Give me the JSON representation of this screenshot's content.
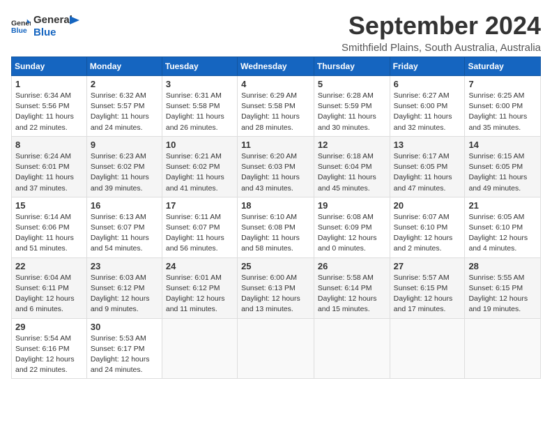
{
  "logo": {
    "line1": "General",
    "line2": "Blue"
  },
  "title": "September 2024",
  "location": "Smithfield Plains, South Australia, Australia",
  "headers": [
    "Sunday",
    "Monday",
    "Tuesday",
    "Wednesday",
    "Thursday",
    "Friday",
    "Saturday"
  ],
  "weeks": [
    [
      {
        "day": "1",
        "detail": "Sunrise: 6:34 AM\nSunset: 5:56 PM\nDaylight: 11 hours\nand 22 minutes."
      },
      {
        "day": "2",
        "detail": "Sunrise: 6:32 AM\nSunset: 5:57 PM\nDaylight: 11 hours\nand 24 minutes."
      },
      {
        "day": "3",
        "detail": "Sunrise: 6:31 AM\nSunset: 5:58 PM\nDaylight: 11 hours\nand 26 minutes."
      },
      {
        "day": "4",
        "detail": "Sunrise: 6:29 AM\nSunset: 5:58 PM\nDaylight: 11 hours\nand 28 minutes."
      },
      {
        "day": "5",
        "detail": "Sunrise: 6:28 AM\nSunset: 5:59 PM\nDaylight: 11 hours\nand 30 minutes."
      },
      {
        "day": "6",
        "detail": "Sunrise: 6:27 AM\nSunset: 6:00 PM\nDaylight: 11 hours\nand 32 minutes."
      },
      {
        "day": "7",
        "detail": "Sunrise: 6:25 AM\nSunset: 6:00 PM\nDaylight: 11 hours\nand 35 minutes."
      }
    ],
    [
      {
        "day": "8",
        "detail": "Sunrise: 6:24 AM\nSunset: 6:01 PM\nDaylight: 11 hours\nand 37 minutes."
      },
      {
        "day": "9",
        "detail": "Sunrise: 6:23 AM\nSunset: 6:02 PM\nDaylight: 11 hours\nand 39 minutes."
      },
      {
        "day": "10",
        "detail": "Sunrise: 6:21 AM\nSunset: 6:02 PM\nDaylight: 11 hours\nand 41 minutes."
      },
      {
        "day": "11",
        "detail": "Sunrise: 6:20 AM\nSunset: 6:03 PM\nDaylight: 11 hours\nand 43 minutes."
      },
      {
        "day": "12",
        "detail": "Sunrise: 6:18 AM\nSunset: 6:04 PM\nDaylight: 11 hours\nand 45 minutes."
      },
      {
        "day": "13",
        "detail": "Sunrise: 6:17 AM\nSunset: 6:05 PM\nDaylight: 11 hours\nand 47 minutes."
      },
      {
        "day": "14",
        "detail": "Sunrise: 6:15 AM\nSunset: 6:05 PM\nDaylight: 11 hours\nand 49 minutes."
      }
    ],
    [
      {
        "day": "15",
        "detail": "Sunrise: 6:14 AM\nSunset: 6:06 PM\nDaylight: 11 hours\nand 51 minutes."
      },
      {
        "day": "16",
        "detail": "Sunrise: 6:13 AM\nSunset: 6:07 PM\nDaylight: 11 hours\nand 54 minutes."
      },
      {
        "day": "17",
        "detail": "Sunrise: 6:11 AM\nSunset: 6:07 PM\nDaylight: 11 hours\nand 56 minutes."
      },
      {
        "day": "18",
        "detail": "Sunrise: 6:10 AM\nSunset: 6:08 PM\nDaylight: 11 hours\nand 58 minutes."
      },
      {
        "day": "19",
        "detail": "Sunrise: 6:08 AM\nSunset: 6:09 PM\nDaylight: 12 hours\nand 0 minutes."
      },
      {
        "day": "20",
        "detail": "Sunrise: 6:07 AM\nSunset: 6:10 PM\nDaylight: 12 hours\nand 2 minutes."
      },
      {
        "day": "21",
        "detail": "Sunrise: 6:05 AM\nSunset: 6:10 PM\nDaylight: 12 hours\nand 4 minutes."
      }
    ],
    [
      {
        "day": "22",
        "detail": "Sunrise: 6:04 AM\nSunset: 6:11 PM\nDaylight: 12 hours\nand 6 minutes."
      },
      {
        "day": "23",
        "detail": "Sunrise: 6:03 AM\nSunset: 6:12 PM\nDaylight: 12 hours\nand 9 minutes."
      },
      {
        "day": "24",
        "detail": "Sunrise: 6:01 AM\nSunset: 6:12 PM\nDaylight: 12 hours\nand 11 minutes."
      },
      {
        "day": "25",
        "detail": "Sunrise: 6:00 AM\nSunset: 6:13 PM\nDaylight: 12 hours\nand 13 minutes."
      },
      {
        "day": "26",
        "detail": "Sunrise: 5:58 AM\nSunset: 6:14 PM\nDaylight: 12 hours\nand 15 minutes."
      },
      {
        "day": "27",
        "detail": "Sunrise: 5:57 AM\nSunset: 6:15 PM\nDaylight: 12 hours\nand 17 minutes."
      },
      {
        "day": "28",
        "detail": "Sunrise: 5:55 AM\nSunset: 6:15 PM\nDaylight: 12 hours\nand 19 minutes."
      }
    ],
    [
      {
        "day": "29",
        "detail": "Sunrise: 5:54 AM\nSunset: 6:16 PM\nDaylight: 12 hours\nand 22 minutes."
      },
      {
        "day": "30",
        "detail": "Sunrise: 5:53 AM\nSunset: 6:17 PM\nDaylight: 12 hours\nand 24 minutes."
      },
      null,
      null,
      null,
      null,
      null
    ]
  ]
}
